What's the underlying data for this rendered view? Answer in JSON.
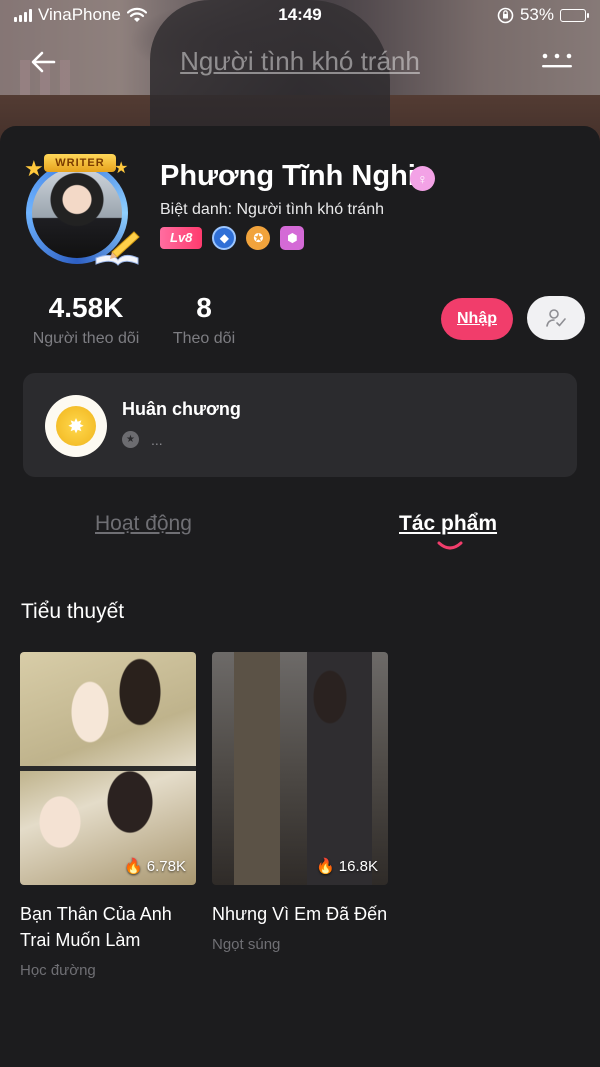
{
  "status_bar": {
    "carrier": "VinaPhone",
    "time": "14:49",
    "battery": "53%",
    "battery_level": 0.53
  },
  "nav": {
    "title": "Người tình khó tránh"
  },
  "profile": {
    "name": "Phương Tĩnh Nghi",
    "nickname": "Biệt danh: Người tình khó tránh",
    "level": "Lv8",
    "avatar_badge": "WRITER"
  },
  "stats": {
    "followers_value": "4.58K",
    "followers_label": "Người theo dõi",
    "following_value": "8",
    "following_label": "Theo dõi"
  },
  "actions": {
    "follow_label": "Nhập"
  },
  "medal": {
    "title": "Huân chương",
    "subtitle": "..."
  },
  "tabs": {
    "activity": "Hoạt động",
    "works": "Tác phẩm"
  },
  "section": {
    "title": "Tiểu thuyết"
  },
  "books": [
    {
      "title": "Bạn Thân Của Anh Trai Muốn Làm",
      "genre": "Học đường",
      "views": "6.78K"
    },
    {
      "title": "Nhưng Vì Em Đã Đến",
      "genre": "Ngọt súng",
      "views": "16.8K"
    }
  ],
  "colors": {
    "background": "#1c1c1e",
    "accent": "#f13d6b",
    "card": "#2b2b2e",
    "muted": "#7d7d82"
  }
}
